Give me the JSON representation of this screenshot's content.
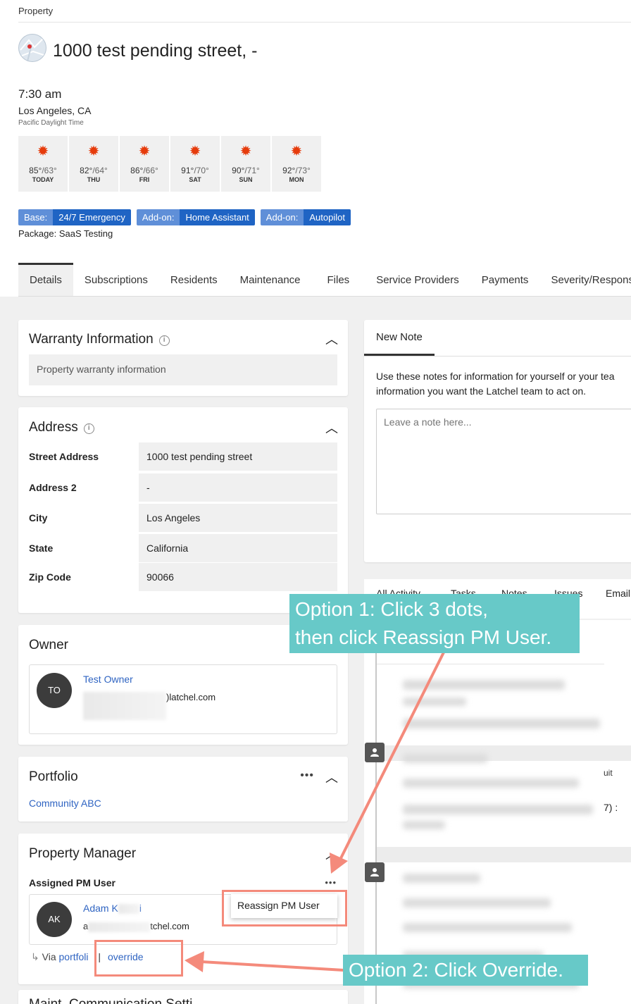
{
  "breadcrumb": "Property",
  "page_title": "1000 test pending street, -",
  "local_time": {
    "time": "7:30 am",
    "location": "Los Angeles, CA",
    "timezone": "Pacific Daylight Time"
  },
  "weather": [
    {
      "high": "85°",
      "low": "/63°",
      "day": "TODAY"
    },
    {
      "high": "82°",
      "low": "/64°",
      "day": "THU"
    },
    {
      "high": "86°",
      "low": "/66°",
      "day": "FRI"
    },
    {
      "high": "91°",
      "low": "/70°",
      "day": "SAT"
    },
    {
      "high": "90°",
      "low": "/71°",
      "day": "SUN"
    },
    {
      "high": "92°",
      "low": "/73°",
      "day": "MON"
    }
  ],
  "packages": [
    {
      "key": "Base:",
      "value": "24/7 Emergency"
    },
    {
      "key": "Add-on:",
      "value": "Home Assistant"
    },
    {
      "key": "Add-on:",
      "value": "Autopilot"
    }
  ],
  "package_name": "Package: SaaS Testing",
  "tabs": [
    "Details",
    "Subscriptions",
    "Residents",
    "Maintenance",
    "Files",
    "Service Providers",
    "Payments",
    "Severity/Responsibi"
  ],
  "warranty": {
    "title": "Warranty Information",
    "placeholder": "Property warranty information"
  },
  "address": {
    "title": "Address",
    "rows": [
      {
        "label": "Street Address",
        "value": "1000 test pending street"
      },
      {
        "label": "Address 2",
        "value": "-"
      },
      {
        "label": "City",
        "value": "Los Angeles"
      },
      {
        "label": "State",
        "value": "California"
      },
      {
        "label": "Zip Code",
        "value": "90066"
      }
    ]
  },
  "owner": {
    "title": "Owner",
    "initials": "TO",
    "name": "Test Owner",
    "email_visible": ")latchel.com"
  },
  "portfolio": {
    "title": "Portfolio",
    "name": "Community ABC"
  },
  "property_manager": {
    "title": "Property Manager",
    "assigned_label": "Assigned PM User",
    "initials": "AK",
    "name_visible": "Adam K",
    "name_tail": "i",
    "email_head": "a",
    "email_tail": "tchel.com",
    "via_text": "Via",
    "via_link": "portfoli",
    "override": "override",
    "menu_item": "Reassign PM User"
  },
  "next_card_title": "Maint. Communication Setti",
  "notes": {
    "tab": "New Note",
    "description_line1": "Use these notes for information for yourself or your tea",
    "description_line2": "information you want the Latchel team to act on.",
    "placeholder": "Leave a note here..."
  },
  "activity_tabs": [
    "All Activity",
    "Tasks",
    "Notes",
    "Issues",
    "Email"
  ],
  "feed_fragments": [
    "uit",
    "7) :"
  ],
  "annotations": {
    "option1_line1": "Option 1: Click 3 dots,",
    "option1_line2": "then click Reassign PM User.",
    "option2": "Option 2: Click Override."
  },
  "colors": {
    "link": "#2f64c2",
    "badge_key": "#5f8fd8",
    "badge_value": "#1f64c4",
    "callout": "#67c9c8",
    "annotation_red": "#f48a7b",
    "sun": "#e63b0b"
  }
}
